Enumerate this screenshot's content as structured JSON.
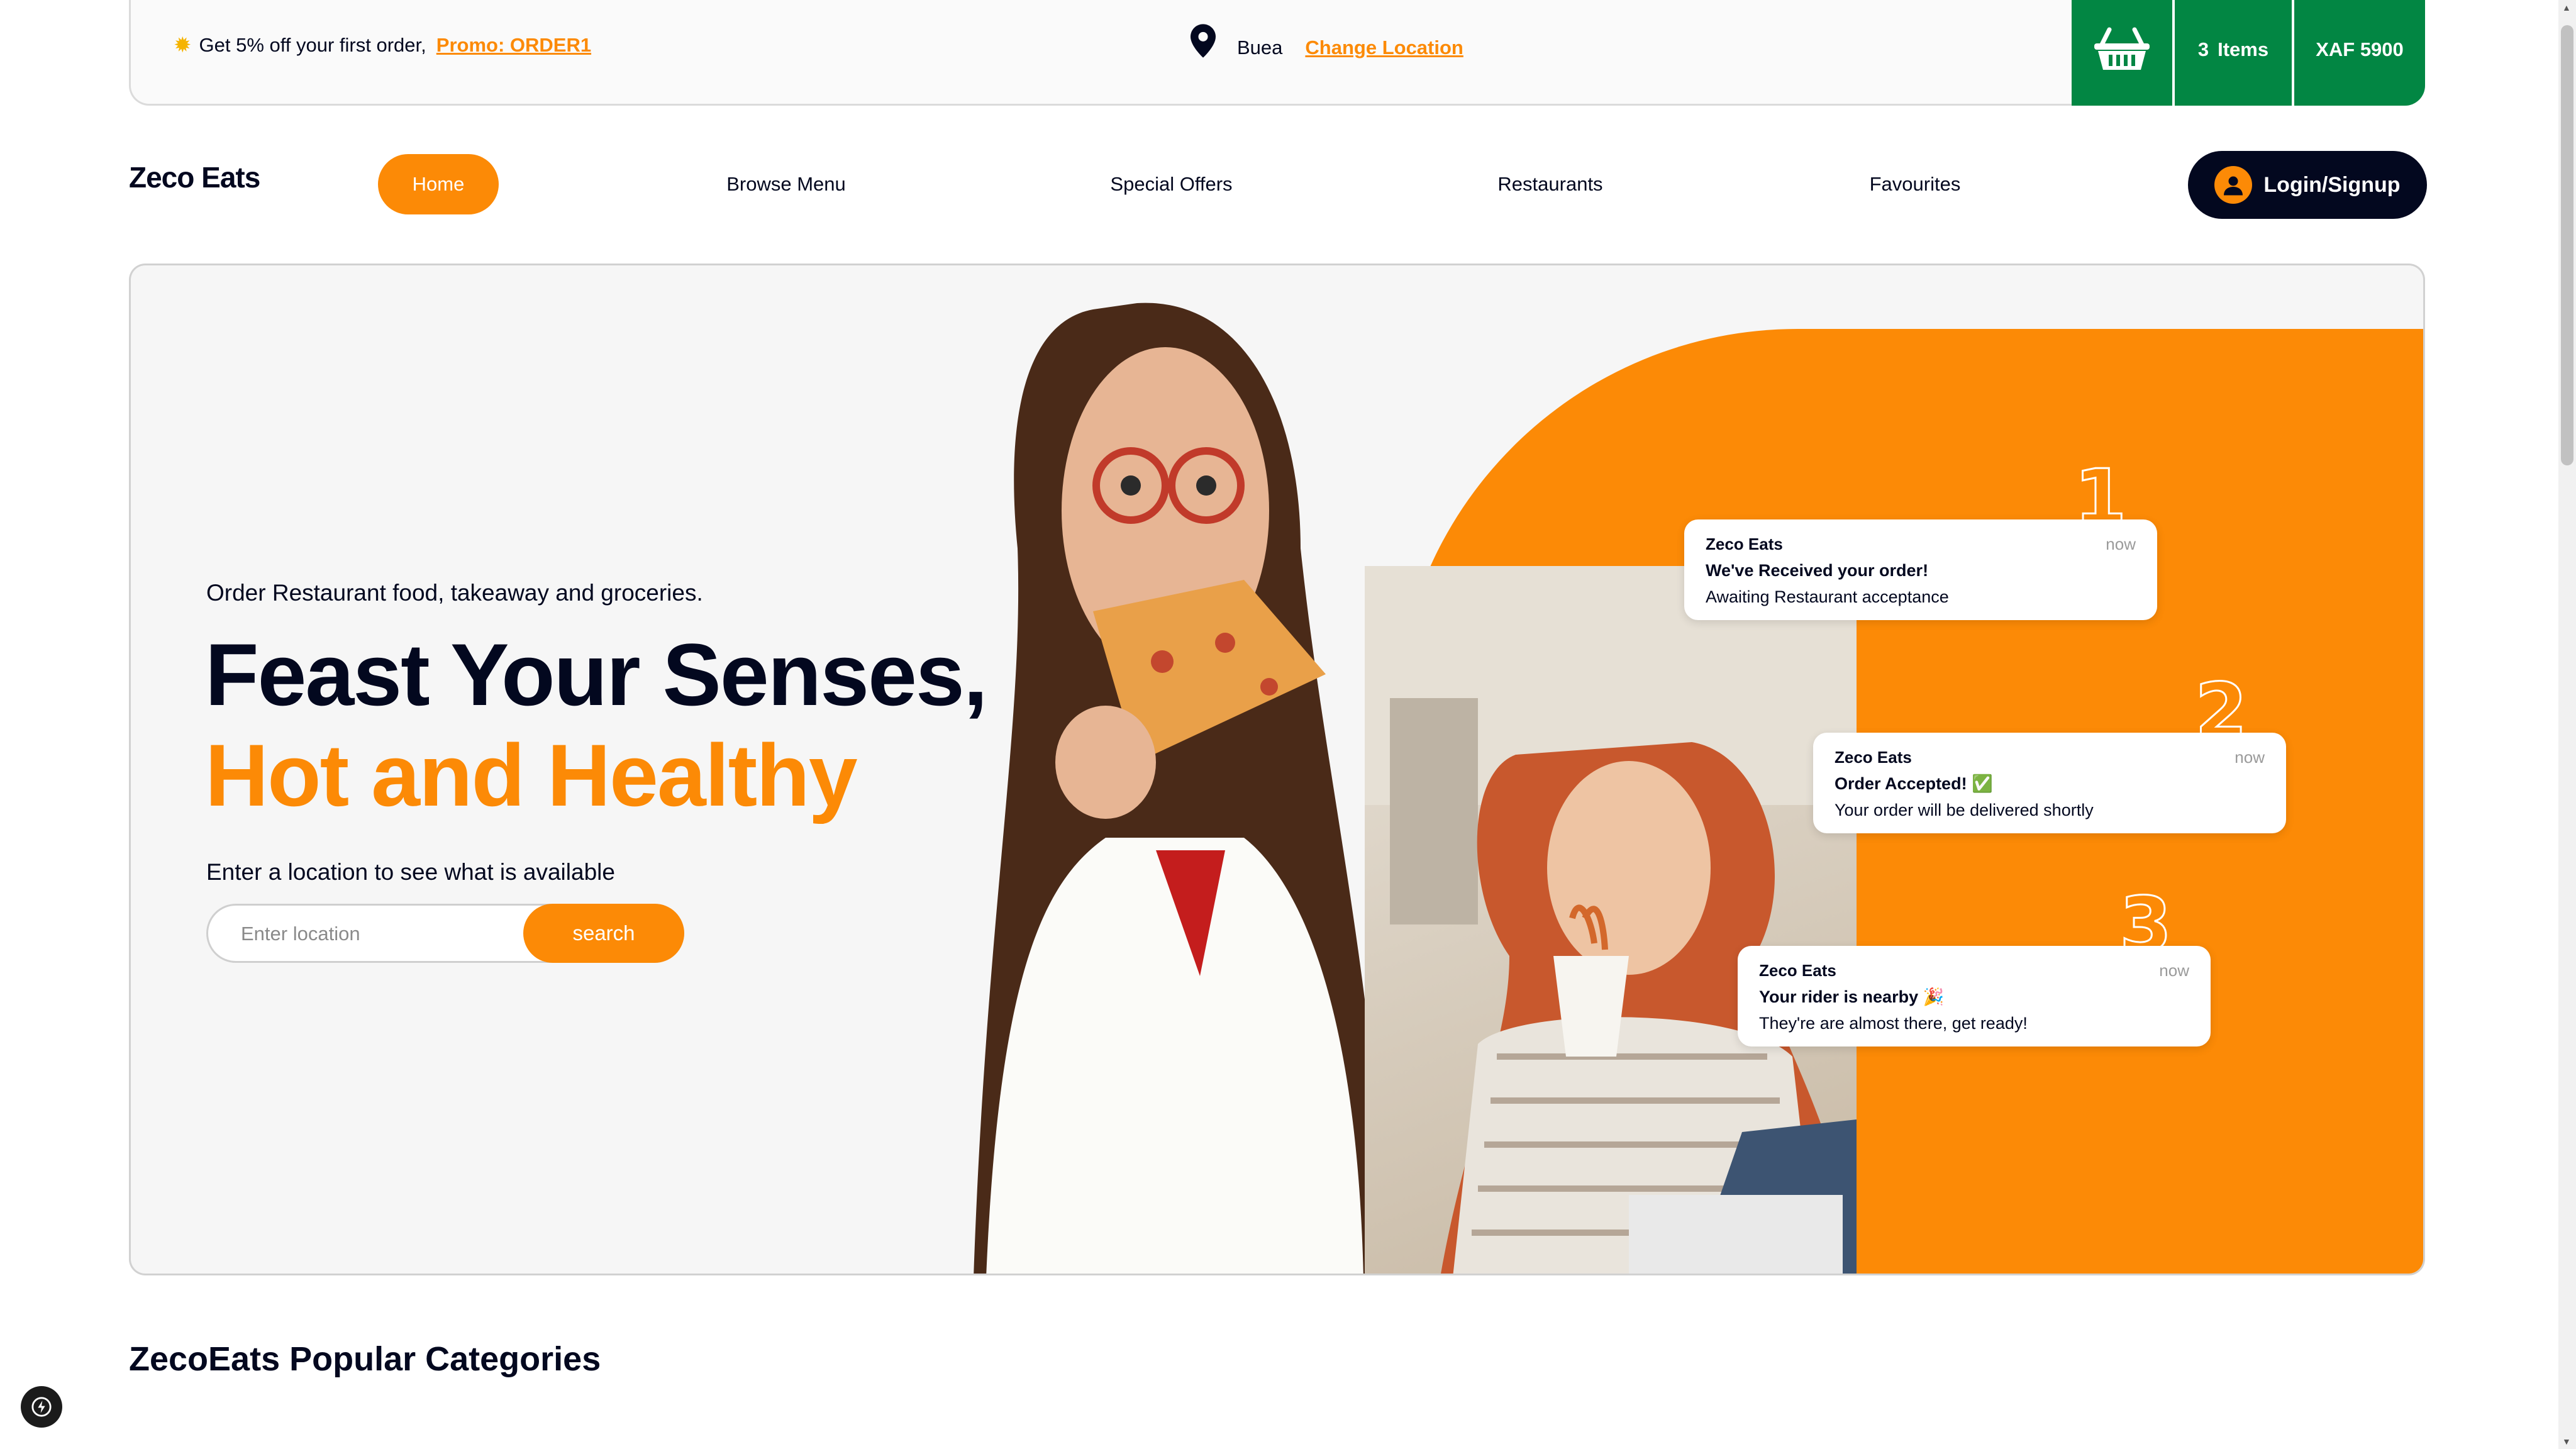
{
  "topbar": {
    "promo_text": "Get 5% off your first order,",
    "promo_code": "Promo: ORDER1",
    "city": "Buea",
    "change_location": "Change Location",
    "cart_items_count": "3",
    "cart_items_label": "Items",
    "cart_total": "XAF 5900"
  },
  "nav": {
    "logo": "Zeco Eats",
    "items": [
      "Home",
      "Browse Menu",
      "Special Offers",
      "Restaurants",
      "Favourites"
    ],
    "login": "Login/Signup"
  },
  "hero": {
    "subtitle": "Order Restaurant food, takeaway and groceries.",
    "headline_1": "Feast Your Senses,",
    "headline_2": "Hot and Healthy",
    "location_prompt": "Enter a location to see what is available",
    "search_placeholder": "Enter location",
    "search_button": "search",
    "notifications": [
      {
        "step": "1",
        "brand": "Zeco Eats",
        "time": "now",
        "title": "We've Received your order!",
        "body": "Awaiting Restaurant acceptance"
      },
      {
        "step": "2",
        "brand": "Zeco Eats",
        "time": "now",
        "title": "Order Accepted! ✅",
        "body": "Your order will be delivered shortly"
      },
      {
        "step": "3",
        "brand": "Zeco Eats",
        "time": "now",
        "title": "Your rider is nearby 🎉",
        "body": "They're are almost there, get ready!"
      }
    ]
  },
  "sections": {
    "categories_title": "ZecoEats Popular Categories"
  },
  "colors": {
    "accent": "#fc8a06",
    "dark": "#03081f",
    "cart_green": "#028643"
  }
}
